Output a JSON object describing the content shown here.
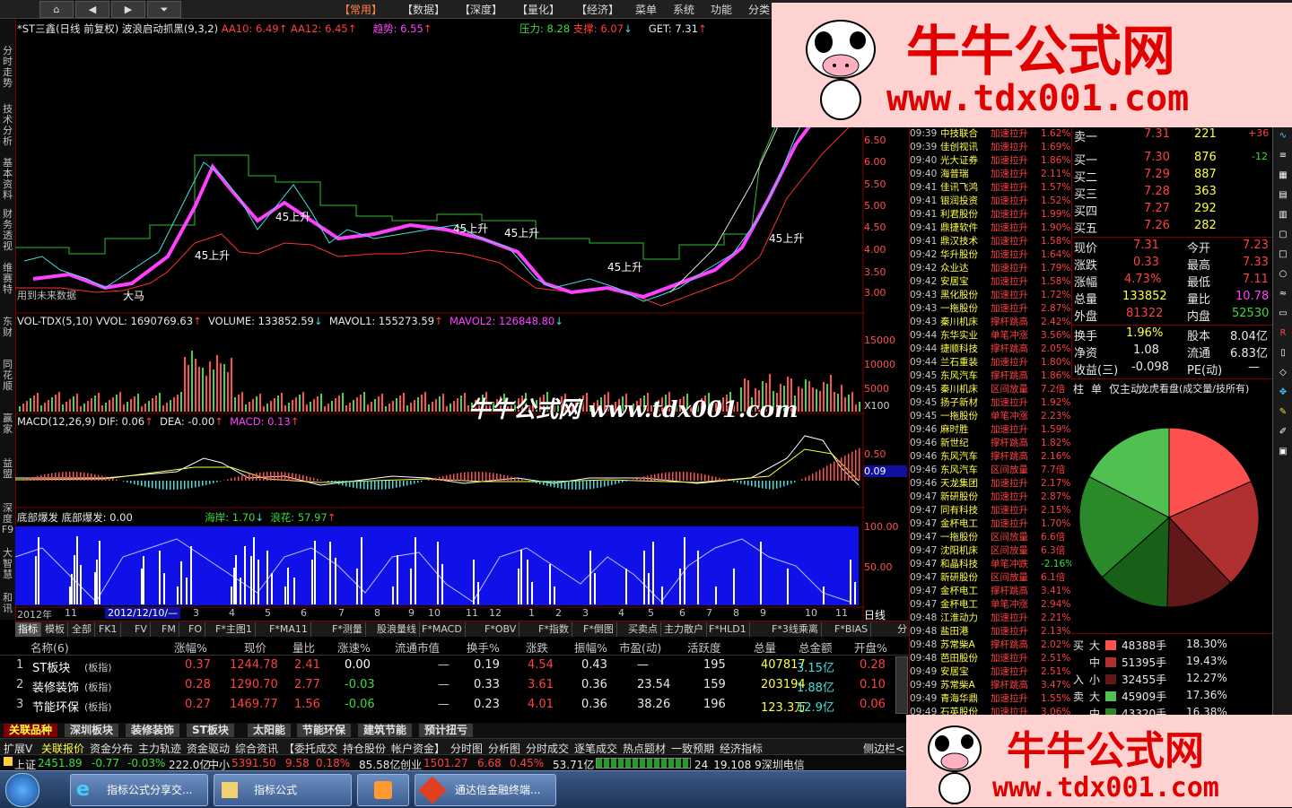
{
  "menubar": {
    "nav": [
      "⌂",
      "◀",
      "▶",
      "⏷"
    ],
    "items": [
      "【常用】",
      "【数据】",
      "【深度】",
      "【量化】",
      "【经济】",
      "菜单",
      "系统",
      "功能",
      "分类"
    ]
  },
  "left_tabs": [
    "分时走势",
    "技术分析",
    "基本资料",
    "财务透视",
    "维赛特",
    "东财",
    "同花顺",
    "赢家",
    "益盟",
    "深度F9",
    "大智慧",
    "和讯"
  ],
  "chart": {
    "title": "*ST三鑫(日线 前复权) 波浪启动抓黑(9,3,2)",
    "aa10_label": "AA10: 6.49",
    "aa12_label": "AA12: 6.45",
    "trend_label": "趋势: 6.55",
    "pressure_label": "压力: 8.28",
    "support_label": "支撑: 6.07",
    "get_label": "GET: 7.31",
    "future_note": "用到未来数据",
    "wave_label": "45上升",
    "dama_label": "大马",
    "price_ticks": [
      "6.50",
      "6.00",
      "5.50",
      "5.00",
      "4.50",
      "4.00",
      "3.50",
      "3.00"
    ],
    "vol_head": "VOL-TDX(5,10)  VVOL: 1690769.63",
    "vol_volume": "VOLUME: 133852.59",
    "vol_mavol1": "MAVOL1: 155273.59",
    "vol_mavol2": "MAVOL2: 126848.80",
    "vol_ticks": [
      "15000",
      "10000",
      "5000"
    ],
    "vol_unit": "X100",
    "macd_head": "MACD(12,26,9)  DIF: 0.06",
    "macd_dea": "DEA: -0.00",
    "macd_macd": "MACD: 0.13",
    "macd_ticks": [
      "0.50",
      "0.09"
    ],
    "bottom_head": "底部爆发  底部爆发: 0.00",
    "haian": "海岸: 1.70",
    "langhua": "浪花: 57.97",
    "bottom_ticks": [
      "100.00",
      "50.00"
    ],
    "date_labels": [
      "2012年",
      "11",
      "2012/12/10/—",
      "3",
      "4",
      "5",
      "6",
      "7",
      "8",
      "9",
      "10",
      "11",
      "12",
      "1",
      "2",
      "3",
      "4",
      "5",
      "6",
      "7",
      "8",
      "9",
      "10",
      "11"
    ],
    "period": "日线"
  },
  "chart_data": [
    {
      "type": "line",
      "title": "*ST三鑫(日线 前复权) 波浪启动抓黑(9,3,2)",
      "x": [
        0,
        10,
        20,
        30,
        40,
        50,
        60,
        70,
        80,
        90,
        100
      ],
      "series": [
        {
          "name": "AA10",
          "values": [
            3.3,
            3.9,
            5.4,
            4.6,
            4.9,
            4.2,
            4.5,
            3.5,
            3.9,
            5.2,
            6.6
          ]
        }
      ],
      "ylim": [
        2.8,
        6.8
      ]
    },
    {
      "type": "bar",
      "title": "VOL-TDX(5,10)",
      "series": [
        {
          "name": "VOLUME",
          "values": [
            1500,
            2000,
            9000,
            4000,
            3000,
            2500,
            3500,
            2000,
            2500,
            5000,
            6000
          ]
        }
      ],
      "ylim": [
        0,
        17000
      ]
    }
  ],
  "ticker": [
    [
      "09:39",
      "中技联合",
      "加速拉升",
      "1.62%"
    ],
    [
      "09:39",
      "佳创视讯",
      "加速拉升",
      "1.69%"
    ],
    [
      "09:40",
      "光大证券",
      "加速拉升",
      "1.86%"
    ],
    [
      "09:40",
      "海普瑞",
      "加速拉升",
      "2.11%"
    ],
    [
      "09:41",
      "佳讯飞鸿",
      "加速拉升",
      "1.57%"
    ],
    [
      "09:41",
      "银润投资",
      "加速拉升",
      "1.52%"
    ],
    [
      "09:41",
      "利君股份",
      "加速拉升",
      "1.99%"
    ],
    [
      "09:41",
      "鼎捷软件",
      "加速拉升",
      "1.90%"
    ],
    [
      "09:41",
      "鼎汉技术",
      "加速拉升",
      "1.58%"
    ],
    [
      "09:42",
      "华升股份",
      "加速拉升",
      "1.64%"
    ],
    [
      "09:42",
      "众业达",
      "加速拉升",
      "1.79%"
    ],
    [
      "09:42",
      "安居宝",
      "加速拉升",
      "1.58%"
    ],
    [
      "09:43",
      "黑化股份",
      "加速拉升",
      "1.72%"
    ],
    [
      "09:43",
      "一拖股份",
      "加速拉升",
      "2.87%"
    ],
    [
      "09:43",
      "秦川机床",
      "撑杆跳高",
      "2.42%"
    ],
    [
      "09:44",
      "东华实业",
      "单笔冲涨",
      "3.56%"
    ],
    [
      "09:44",
      "捷顺科技",
      "撑杆跳高",
      "2.05%"
    ],
    [
      "09:44",
      "兰石重装",
      "加速拉升",
      "1.80%"
    ],
    [
      "09:45",
      "东风汽车",
      "撑杆跳高",
      "1.86%"
    ],
    [
      "09:45",
      "秦川机床",
      "区间放量",
      "7.2倍"
    ],
    [
      "09:45",
      "扬子新材",
      "加速拉升",
      "1.92%"
    ],
    [
      "09:45",
      "一拖股份",
      "单笔冲涨",
      "2.23%"
    ],
    [
      "09:46",
      "麻时胜",
      "加速拉升",
      "1.59%"
    ],
    [
      "09:46",
      "新世纪",
      "撑杆跳高",
      "1.82%"
    ],
    [
      "09:46",
      "东风汽车",
      "撑杆跳高",
      "2.16%"
    ],
    [
      "09:46",
      "东风汽车",
      "区间放量",
      "7.7倍"
    ],
    [
      "09:46",
      "天龙集团",
      "加速拉升",
      "2.17%"
    ],
    [
      "09:47",
      "新研股份",
      "加速拉升",
      "2.87%"
    ],
    [
      "09:47",
      "同有科技",
      "加速拉升",
      "2.15%"
    ],
    [
      "09:47",
      "金杯电工",
      "加速拉升",
      "1.70%"
    ],
    [
      "09:47",
      "一拖股份",
      "区间放量",
      "6.6倍"
    ],
    [
      "09:47",
      "沈阳机床",
      "区间放量",
      "6.3倍"
    ],
    [
      "09:47",
      "和晶科技",
      "单笔冲跌",
      "-2.16%"
    ],
    [
      "09:47",
      "新研股份",
      "区间放量",
      "6.1倍"
    ],
    [
      "09:47",
      "金杯电工",
      "撑杆跳高",
      "3.41%"
    ],
    [
      "09:47",
      "金杯电工",
      "单笔冲涨",
      "2.94%"
    ],
    [
      "09:48",
      "江淮动力",
      "加速拉升",
      "2.21%"
    ],
    [
      "09:48",
      "盐田港",
      "加速拉升",
      "2.13%"
    ],
    [
      "09:48",
      "苏常柴A",
      "撑杆跳高",
      "2.02%"
    ],
    [
      "09:48",
      "芭田股份",
      "加速拉升",
      "2.51%"
    ],
    [
      "09:49",
      "安居宝",
      "加速拉升",
      "2.51%"
    ],
    [
      "09:49",
      "苏常柴A",
      "撑杆跳高",
      "3.47%"
    ],
    [
      "09:49",
      "青海华鼎",
      "加速拉升",
      "1.55%"
    ],
    [
      "09:49",
      "石英股份",
      "加速拉升",
      "3.06%"
    ]
  ],
  "quote": {
    "sell1_label": "卖一",
    "sell1_price": "7.31",
    "sell1_vol": "221",
    "sell1_chg": "+36",
    "buy1_label": "买一",
    "buy1_price": "7.30",
    "buy1_vol": "876",
    "buy1_chg": "-12",
    "buy2_label": "买二",
    "buy2_price": "7.29",
    "buy2_vol": "887",
    "buy3_label": "买三",
    "buy3_price": "7.28",
    "buy3_vol": "363",
    "buy4_label": "买四",
    "buy4_price": "7.27",
    "buy4_vol": "292",
    "buy5_label": "买五",
    "buy5_price": "7.26",
    "buy5_vol": "282",
    "price_label": "现价",
    "price": "7.31",
    "open_label": "今开",
    "open": "7.23",
    "chg_label": "涨跌",
    "chg": "0.33",
    "high_label": "最高",
    "high": "7.33",
    "pct_label": "涨幅",
    "pct": "4.73%",
    "low_label": "最低",
    "low": "7.11",
    "vol_label": "总量",
    "vol": "133852",
    "ratio_label": "量比",
    "ratio": "10.78",
    "outer_label": "外盘",
    "outer": "81322",
    "inner_label": "内盘",
    "inner": "52530",
    "turn_label": "换手",
    "turn": "1.96%",
    "cap_label": "股本",
    "cap": "8.04亿",
    "nav_label": "净资",
    "nav": "1.08",
    "float_label": "流通",
    "float": "6.83亿",
    "eps_label": "收益(三)",
    "eps": "-0.098",
    "pe_label": "PE(动)",
    "pe": "—"
  },
  "pie_head": [
    "柱",
    "单",
    "仅主动",
    "龙虎看盘(成交量/技所有)"
  ],
  "pie": [
    {
      "label": "大买",
      "value": 18.3,
      "color": "#ff5050"
    },
    {
      "label": "中买",
      "value": 19.43,
      "color": "#b03030"
    },
    {
      "label": "小买",
      "value": 12.27,
      "color": "#601818"
    },
    {
      "label": "小卖",
      "value": 13.0,
      "color": "#186018"
    },
    {
      "label": "中卖",
      "value": 19.0,
      "color": "#2a8a2a"
    },
    {
      "label": "大卖",
      "value": 17.36,
      "color": "#50c050"
    }
  ],
  "volbox": [
    [
      "买",
      "大",
      "48388手",
      "18.30%",
      "#ff5050"
    ],
    [
      "",
      "中",
      "51395手",
      "19.43%",
      "#b03030"
    ],
    [
      "入",
      "小",
      "32455手",
      "12.27%",
      "#601818"
    ],
    [
      "卖",
      "大",
      "45909手",
      "17.36%",
      "#50c050"
    ],
    [
      "",
      "中",
      "43320手",
      "16.38%",
      "#2a8a2a"
    ]
  ],
  "toolbar": [
    "指标",
    "模板",
    "全部",
    "FK1",
    "FV",
    "FM",
    "FO",
    "F*主图1",
    "F*MA11",
    "F*测量",
    "股浪量线",
    "F*MACD",
    "F*OBV",
    "F*指数",
    "F*倒图",
    "买卖点",
    "主力散户",
    "F*HLD1",
    "F*3线乘离",
    "F*BIAS",
    "分时买卖",
    "分时涨停"
  ],
  "table": {
    "headers": [
      "名称(6)",
      "涨幅%",
      "现价",
      "量比",
      "涨速%",
      "流通市值",
      "换手%",
      "涨跌",
      "振幅%",
      "市盈(动)",
      "活跃度",
      "总量",
      "总金额",
      "开盘%"
    ],
    "rows": [
      [
        "1",
        "ST板块",
        "(板指)",
        "0.37",
        "1244.78",
        "2.41",
        "0.00",
        "—",
        "0.19",
        "4.54",
        "0.43",
        "—",
        "195",
        "407817",
        "3.15亿",
        "0.28"
      ],
      [
        "2",
        "装修装饰",
        "(板指)",
        "0.28",
        "1290.70",
        "2.77",
        "-0.03",
        "—",
        "0.33",
        "3.61",
        "0.36",
        "23.54",
        "159",
        "203194",
        "1.88亿",
        "0.10"
      ],
      [
        "3",
        "节能环保",
        "(板指)",
        "0.27",
        "1469.77",
        "1.56",
        "-0.06",
        "—",
        "0.23",
        "4.01",
        "0.36",
        "38.26",
        "196",
        "123.3万",
        "12.9亿",
        "0.06"
      ]
    ]
  },
  "sector_tabs": [
    "关联品种",
    "深圳板块",
    "装修装饰",
    "ST板块",
    "太阳能",
    "节能环保",
    "建筑节能",
    "预计扭亏"
  ],
  "func_tabs": [
    "扩展V",
    "关联报价",
    "资金分布",
    "主力轨迹",
    "资金驱动",
    "综合资讯",
    "【委托成交",
    "持仓股份",
    "帐户资金】",
    "分时图",
    "分析图",
    "分时成交",
    "逐笔成交",
    "热点题材",
    "一致预期",
    "经济指标",
    "侧边栏<"
  ],
  "status": {
    "sh_label": "上证",
    "sh": "2451.89",
    "sh_chg": "-0.77",
    "sh_pct": "-0.03%",
    "sh_amt": "222.0亿",
    "zx_label": "中小",
    "zx": "5391.50",
    "zx_chg": "9.58",
    "zx_pct": "0.18%",
    "zx_amt": "85.58亿",
    "cy_label": "创业",
    "cy": "1501.27",
    "cy_chg": "6.68",
    "cy_pct": "0.45%",
    "cy_amt": "53.71亿",
    "extra": "24_19.108  9深圳电信"
  },
  "taskbar": [
    "指标公式分享交...",
    "指标公式",
    "",
    "通达信金融终端..."
  ],
  "watermark": {
    "title": "牛牛公式网",
    "url": "www.tdx001.com",
    "overlay": "牛牛公式网 www.tdx001.com"
  }
}
